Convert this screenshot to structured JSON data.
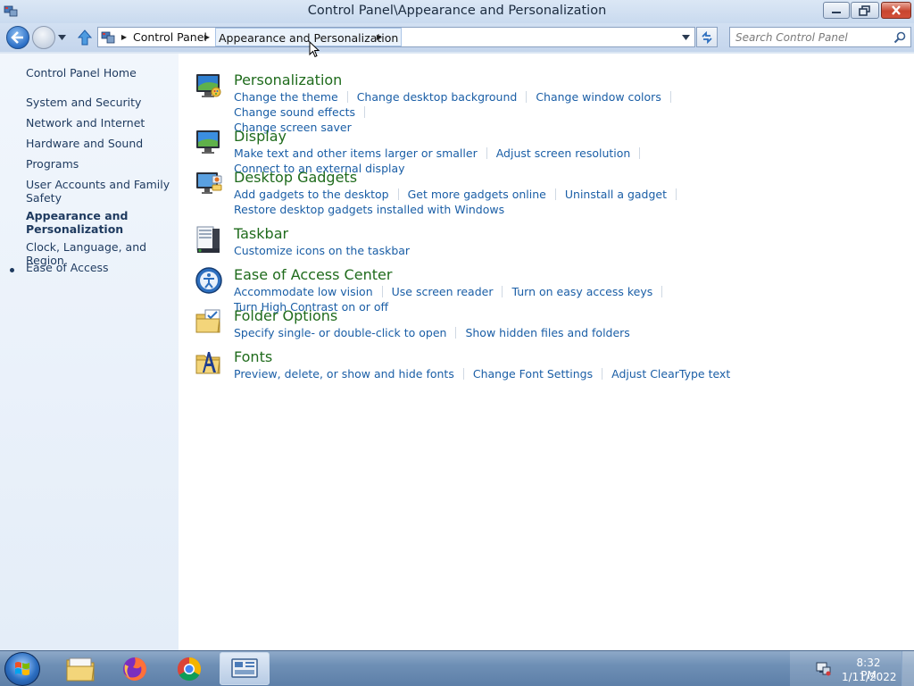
{
  "window": {
    "title": "Control Panel\\Appearance and Personalization",
    "buttons": {
      "minimize": "minimize",
      "maximize": "restore",
      "close": "close"
    }
  },
  "navbar": {
    "breadcrumbs": [
      "Control Panel",
      "Appearance and Personalization"
    ],
    "search_placeholder": "Search Control Panel"
  },
  "sidebar": {
    "home": "Control Panel Home",
    "items": [
      "System and Security",
      "Network and Internet",
      "Hardware and Sound",
      "Programs",
      "User Accounts and Family Safety",
      "Appearance and Personalization",
      "Clock, Language, and Region",
      "Ease of Access"
    ],
    "current_index": 5
  },
  "categories": [
    {
      "title": "Personalization",
      "icon": "personalization-icon",
      "links": [
        "Change the theme",
        "Change desktop background",
        "Change window colors",
        "Change sound effects",
        "Change screen saver"
      ]
    },
    {
      "title": "Display",
      "icon": "display-icon",
      "links": [
        "Make text and other items larger or smaller",
        "Adjust screen resolution",
        "Connect to an external display"
      ]
    },
    {
      "title": "Desktop Gadgets",
      "icon": "gadgets-icon",
      "links": [
        "Add gadgets to the desktop",
        "Get more gadgets online",
        "Uninstall a gadget",
        "Restore desktop gadgets installed with Windows"
      ]
    },
    {
      "title": "Taskbar",
      "icon": "taskbar-icon",
      "links": [
        "Customize icons on the taskbar"
      ]
    },
    {
      "title": "Ease of Access Center",
      "icon": "ease-of-access-icon",
      "links": [
        "Accommodate low vision",
        "Use screen reader",
        "Turn on easy access keys",
        "Turn High Contrast on or off"
      ]
    },
    {
      "title": "Folder Options",
      "icon": "folder-options-icon",
      "links": [
        "Specify single- or double-click to open",
        "Show hidden files and folders"
      ]
    },
    {
      "title": "Fonts",
      "icon": "fonts-icon",
      "links": [
        "Preview, delete, or show and hide fonts",
        "Change Font Settings",
        "Adjust ClearType text"
      ]
    }
  ],
  "taskbar": {
    "apps": [
      "file-explorer-icon",
      "firefox-icon",
      "chrome-icon",
      "control-panel-icon"
    ],
    "time": "8:32 PM",
    "date": "1/11/2022"
  },
  "colors": {
    "link": "#1a5ea6",
    "category_title": "#1f6b1c",
    "sidebar_text": "#1e3a5f"
  }
}
